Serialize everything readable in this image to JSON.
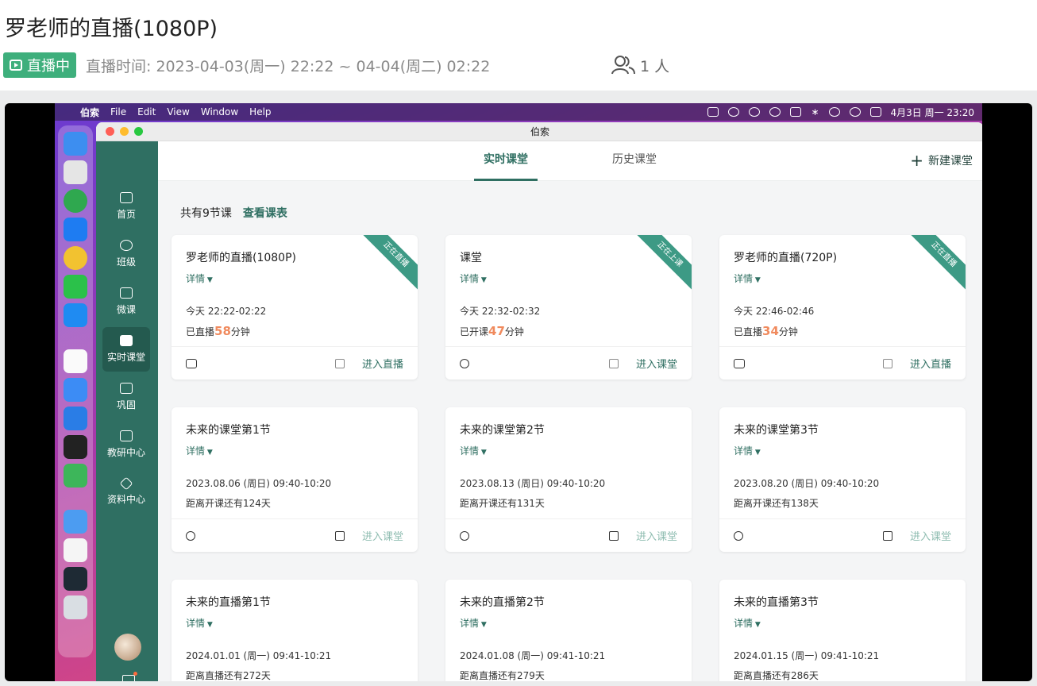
{
  "stream": {
    "title": "罗老师的直播(1080P)",
    "badge": "直播中",
    "time_range": "直播时间: 2023-04-03(周一) 22:22 ~ 04-04(周二) 02:22",
    "viewers": "1 人"
  },
  "menubar": {
    "apple": "",
    "app_name": "伯索",
    "items": [
      "File",
      "Edit",
      "View",
      "Window",
      "Help"
    ],
    "clock": "4月3日 周一 23:20"
  },
  "window": {
    "title": "伯索"
  },
  "sidebar": {
    "items": [
      {
        "label": "首页"
      },
      {
        "label": "班级"
      },
      {
        "label": "微课"
      },
      {
        "label": "实时课堂"
      },
      {
        "label": "巩固"
      },
      {
        "label": "教研中心"
      },
      {
        "label": "资料中心"
      }
    ]
  },
  "tabs": {
    "realtime": "实时课堂",
    "history": "历史课堂"
  },
  "new_class": "新建课堂",
  "summary": {
    "count_text": "共有9节课",
    "link": "查看课表"
  },
  "cards": [
    {
      "title": "罗老师的直播(1080P)",
      "detail": "详情",
      "time": "今天 22:22-02:22",
      "status_prefix": "已直播",
      "status_num": "58",
      "status_suffix": "分钟",
      "ribbon": "正在直播",
      "action": "进入直播"
    },
    {
      "title": "课堂",
      "detail": "详情",
      "time": "今天 22:32-02:32",
      "status_prefix": "已开课",
      "status_num": "47",
      "status_suffix": "分钟",
      "ribbon": "正在上课",
      "action": "进入课堂"
    },
    {
      "title": "罗老师的直播(720P)",
      "detail": "详情",
      "time": "今天 22:46-02:46",
      "status_prefix": "已直播",
      "status_num": "34",
      "status_suffix": "分钟",
      "ribbon": "正在直播",
      "action": "进入直播"
    },
    {
      "title": "未来的课堂第1节",
      "detail": "详情",
      "time": "2023.08.06 (周日) 09:40-10:20",
      "status_prefix": "距离开课还有124天",
      "status_num": "",
      "status_suffix": "",
      "ribbon": "",
      "action": "进入课堂"
    },
    {
      "title": "未来的课堂第2节",
      "detail": "详情",
      "time": "2023.08.13 (周日) 09:40-10:20",
      "status_prefix": "距离开课还有131天",
      "status_num": "",
      "status_suffix": "",
      "ribbon": "",
      "action": "进入课堂"
    },
    {
      "title": "未来的课堂第3节",
      "detail": "详情",
      "time": "2023.08.20 (周日) 09:40-10:20",
      "status_prefix": "距离开课还有138天",
      "status_num": "",
      "status_suffix": "",
      "ribbon": "",
      "action": "进入课堂"
    },
    {
      "title": "未来的直播第1节",
      "detail": "详情",
      "time": "2024.01.01 (周一) 09:41-10:21",
      "status_prefix": "距离直播还有272天",
      "status_num": "",
      "status_suffix": "",
      "ribbon": "",
      "action": ""
    },
    {
      "title": "未来的直播第2节",
      "detail": "详情",
      "time": "2024.01.08 (周一) 09:41-10:21",
      "status_prefix": "距离直播还有279天",
      "status_num": "",
      "status_suffix": "",
      "ribbon": "",
      "action": ""
    },
    {
      "title": "未来的直播第3节",
      "detail": "详情",
      "time": "2024.01.15 (周一) 09:41-10:21",
      "status_prefix": "距离直播还有286天",
      "status_num": "",
      "status_suffix": "",
      "ribbon": "",
      "action": ""
    }
  ],
  "colors": {
    "accent": "#2f6f62",
    "live_badge": "#3eaf7c",
    "highlight_num": "#f08a5d"
  }
}
